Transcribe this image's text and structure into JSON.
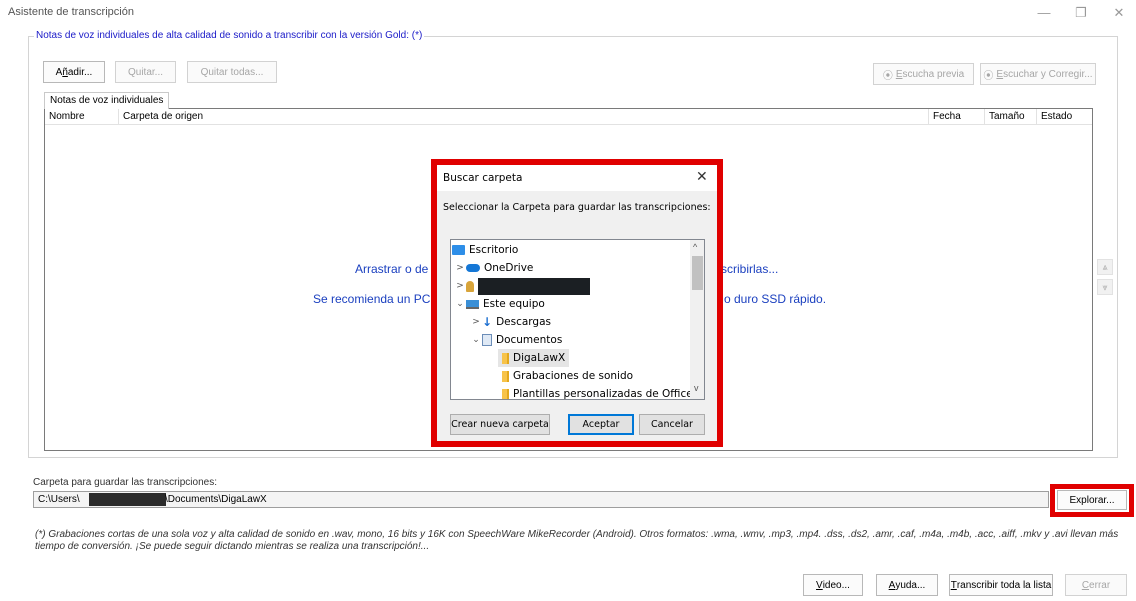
{
  "window": {
    "title": "Asistente de transcripción",
    "minimize": "—",
    "restore": "❐",
    "close": "✕"
  },
  "group": {
    "legend": "Notas de voz individuales de alta calidad de sonido a transcribir con la versión Gold: (*)"
  },
  "toolbar": {
    "add_prefix": "A",
    "add_underlined": "ñ",
    "add_rest": "adir...",
    "remove": "Quitar...",
    "remove_all": "Quitar todas...",
    "preview_icon": "⦿",
    "preview_underlined": "E",
    "preview_rest": "scucha previa",
    "listen_correct_icon": "⦿",
    "listen_correct_underlined": "E",
    "listen_correct_rest": "scuchar y Corregir..."
  },
  "tab": {
    "label": "Notas de voz individuales"
  },
  "list": {
    "columns": [
      "Nombre",
      "Carpeta de origen",
      "Fecha",
      "Tamaño",
      "Estado"
    ],
    "drop_text_1a": "Arrastrar o de",
    "drop_text_1b": "scribirlas...",
    "drop_text_2a": "Se recomienda un PC",
    "drop_text_2b": "o duro SSD rápido.",
    "up_arrow": "⩓",
    "down_arrow": "⩔"
  },
  "dialog": {
    "title": "Buscar carpeta",
    "close": "✕",
    "prompt": "Seleccionar la Carpeta para guardar las transcripciones:",
    "tree": [
      {
        "label": "Escritorio",
        "chevron": "",
        "icon": "desktop"
      },
      {
        "label": "OneDrive",
        "chevron": ">",
        "icon": "cloud"
      },
      {
        "label": "",
        "chevron": ">",
        "icon": "user"
      },
      {
        "label": "Este equipo",
        "chevron": "⌄",
        "icon": "computer"
      },
      {
        "label": "Descargas",
        "chevron": ">",
        "icon": "download"
      },
      {
        "label": "Documentos",
        "chevron": "⌄",
        "icon": "documents"
      },
      {
        "label": "DigaLawX",
        "chevron": "",
        "icon": "folder",
        "selected": true
      },
      {
        "label": "Grabaciones de sonido",
        "chevron": "",
        "icon": "folder"
      },
      {
        "label": "Plantillas personalizadas de Office",
        "chevron": "",
        "icon": "folder"
      }
    ],
    "scroll_up": "^",
    "scroll_down": "v",
    "new_folder": "Crear nueva carpeta",
    "accept": "Aceptar",
    "cancel": "Cancelar"
  },
  "save": {
    "label": "Carpeta para guardar las transcripciones:",
    "path_start": "C:\\Users\\",
    "path_end": "\\Documents\\DigaLawX",
    "browse": "Explorar..."
  },
  "footnote": "(*) Grabaciones cortas de una sola voz y alta calidad de sonido en .wav, mono, 16 bits y 16K con SpeechWare MikeRecorder (Android). Otros formatos: .wma, .wmv, .mp3, .mp4. .dss, .ds2, .amr, .caf, .m4a, .m4b, .acc, .aiff, .mkv y .avi llevan más tiempo de conversión. ¡Se puede seguir dictando mientras se realiza una transcripción!...",
  "footer": {
    "video_underlined": "V",
    "video_rest": "ideo...",
    "help_underlined": "A",
    "help_rest": "yuda...",
    "transcribe_underlined": "T",
    "transcribe_rest": "ranscribir toda la lista",
    "close_underlined": "C",
    "close_rest": "errar"
  },
  "colors": {
    "accent": "#1a3fbf",
    "highlight_frame": "#e00000"
  }
}
